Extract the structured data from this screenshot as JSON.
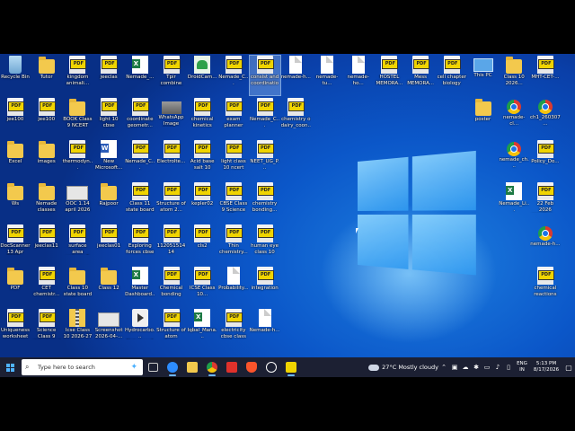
{
  "desktop": {
    "icons": [
      {
        "label": "Recycle Bin",
        "type": "bin"
      },
      {
        "label": "Tutor",
        "type": "folder"
      },
      {
        "label": "kingdom animali...",
        "type": "pdf"
      },
      {
        "label": "jeeclas",
        "type": "pdf"
      },
      {
        "label": "Nemade_...",
        "type": "xls"
      },
      {
        "label": "Tpir combine Chemical li...",
        "type": "pdf"
      },
      {
        "label": "DroidCam...",
        "type": "apk"
      },
      {
        "label": "Nemade_C...",
        "type": "pdf"
      },
      {
        "label": "consist and coordination",
        "type": "pdf"
      },
      {
        "label": "nemade-h...",
        "type": "doc"
      },
      {
        "label": "nemade-tu...",
        "type": "doc"
      },
      {
        "label": "nemade-ho...",
        "type": "doc"
      },
      {
        "label": "HOSTEL MEMORA...",
        "type": "pdf"
      },
      {
        "label": "Mess MEMORA...",
        "type": "pdf"
      },
      {
        "label": "cell chapter biology",
        "type": "pdf"
      },
      {
        "label": "This PC",
        "type": "pc"
      },
      {
        "label": "Class 10 2026...",
        "type": "folder"
      },
      {
        "label": "MHT-CET-...",
        "type": "pdf"
      },
      {
        "label": "jee100",
        "type": "pdf"
      },
      {
        "label": "jee100",
        "type": "pdf"
      },
      {
        "label": "BOOK Class 9 NCERT",
        "type": "folder"
      },
      {
        "label": "light 10 cbse",
        "type": "pdf"
      },
      {
        "label": "coordinate geometr...",
        "type": "pdf"
      },
      {
        "label": "WhatsApp Image 2026...",
        "type": "img"
      },
      {
        "label": "chemical kinetics",
        "type": "pdf"
      },
      {
        "label": "exam planner",
        "type": "pdf"
      },
      {
        "label": "Nemade_C...",
        "type": "pdf"
      },
      {
        "label": "chemistry o dairy_coon...",
        "type": "pdf"
      },
      {
        "label": "poster",
        "type": "folder"
      },
      {
        "label": "nemade-cl...",
        "type": "chrome"
      },
      {
        "label": "ch1_260307...",
        "type": "chrome"
      },
      {
        "label": "Excel",
        "type": "folder"
      },
      {
        "label": "images",
        "type": "folder"
      },
      {
        "label": "thermodyn...",
        "type": "pdf"
      },
      {
        "label": "New Microsoft...",
        "type": "word"
      },
      {
        "label": "Nemade_C...",
        "type": "pdf"
      },
      {
        "label": "Electrolte...",
        "type": "pdf"
      },
      {
        "label": "Acid base salt 10",
        "type": "pdf"
      },
      {
        "label": "light class 10 ncert",
        "type": "pdf"
      },
      {
        "label": "NEET_UG_P...",
        "type": "pdf"
      },
      {
        "label": "nemade_ch...",
        "type": "chrome"
      },
      {
        "label": "Policy_Do...",
        "type": "pdf"
      },
      {
        "label": "Ws",
        "type": "folder"
      },
      {
        "label": "Nemade classes",
        "type": "folder"
      },
      {
        "label": "OOC 1.14 april 2026",
        "type": "shot"
      },
      {
        "label": "Rajpoor",
        "type": "folder"
      },
      {
        "label": "Class 11 state board",
        "type": "pdf"
      },
      {
        "label": "Structure of atom 2...",
        "type": "pdf"
      },
      {
        "label": "kepler02",
        "type": "pdf"
      },
      {
        "label": "CBSE Class 9 Science 15...",
        "type": "pdf"
      },
      {
        "label": "chemistry bonding...",
        "type": "pdf"
      },
      {
        "label": "Nemade_Li...",
        "type": "xls"
      },
      {
        "label": "22 Feb 2026 meeting ...",
        "type": "pdf"
      },
      {
        "label": "DocScanner 13 Apr 2026...",
        "type": "pdf"
      },
      {
        "label": "jeeclas11",
        "type": "pdf"
      },
      {
        "label": "surface area volume 2 (1)",
        "type": "pdf"
      },
      {
        "label": "jeeclas01",
        "type": "pdf"
      },
      {
        "label": "Exploring forces cbse",
        "type": "pdf"
      },
      {
        "label": "11205151414",
        "type": "pdf"
      },
      {
        "label": "cls2",
        "type": "pdf"
      },
      {
        "label": "Thin chemistry...",
        "type": "pdf"
      },
      {
        "label": "human eye class 10 ncert",
        "type": "pdf"
      },
      {
        "label": "nemade-h...",
        "type": "chrome"
      },
      {
        "label": "PDF",
        "type": "folder"
      },
      {
        "label": "CET chemistr...",
        "type": "pdf"
      },
      {
        "label": "Class 10 state board bio...",
        "type": "folder"
      },
      {
        "label": "Class 12",
        "type": "folder"
      },
      {
        "label": "Master Dashboard...",
        "type": "xls"
      },
      {
        "label": "Chemical bonding",
        "type": "pdf"
      },
      {
        "label": "ICSE Class 10...",
        "type": "pdf"
      },
      {
        "label": "Probability...",
        "type": "doc"
      },
      {
        "label": "integration",
        "type": "pdf"
      },
      {
        "label": "chemical reactions a...",
        "type": "pdf"
      },
      {
        "label": "Uniqueness worksheet",
        "type": "pdf"
      },
      {
        "label": "Science Class 9 state board",
        "type": "pdf"
      },
      {
        "label": "Icse Class 10 2026-27",
        "type": "zip"
      },
      {
        "label": "Screenshot 2026-04-...",
        "type": "shot"
      },
      {
        "label": "Hydrocarbo... Notes.mp4",
        "type": "mp"
      },
      {
        "label": "Structure of atom class...",
        "type": "pdf"
      },
      {
        "label": "Iqbal_Mana...",
        "type": "xls"
      },
      {
        "label": "electricity cbse class 1...",
        "type": "pdf"
      },
      {
        "label": "Nemade-h...",
        "type": "doc"
      }
    ]
  },
  "taskbar": {
    "search_placeholder": "Type here to search",
    "apps": [
      "task-view",
      "zoom",
      "file-explorer",
      "chrome",
      "pdf-reader",
      "brave",
      "chatgpt",
      "pdf-app"
    ],
    "weather_temp": "27°C",
    "weather_text": "Mostly cloudy",
    "lang_line1": "ENG",
    "lang_line2": "IN",
    "time": "5:13 PM",
    "date": "8/17/2026"
  }
}
